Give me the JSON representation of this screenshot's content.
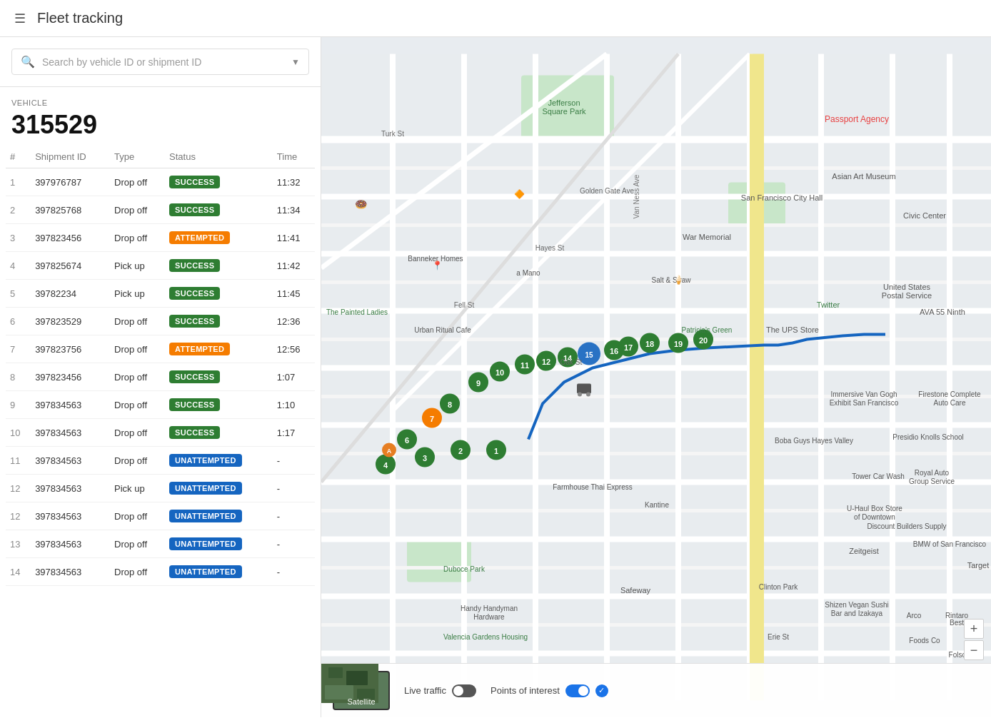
{
  "header": {
    "title": "Fleet tracking",
    "hamburger_label": "☰"
  },
  "sidebar": {
    "search": {
      "placeholder": "Search by vehicle ID or shipment ID"
    },
    "vehicle_label": "VEHICLE",
    "vehicle_id": "315529",
    "table": {
      "columns": [
        "#",
        "Shipment ID",
        "Type",
        "Status",
        "Time"
      ],
      "rows": [
        {
          "num": 1,
          "shipment_id": "397976787",
          "type": "Drop off",
          "status": "SUCCESS",
          "status_class": "success",
          "time": "11:32"
        },
        {
          "num": 2,
          "shipment_id": "397825768",
          "type": "Drop off",
          "status": "SUCCESS",
          "status_class": "success",
          "time": "11:34"
        },
        {
          "num": 3,
          "shipment_id": "397823456",
          "type": "Drop off",
          "status": "ATTEMPTED",
          "status_class": "attempted",
          "time": "11:41"
        },
        {
          "num": 4,
          "shipment_id": "397825674",
          "type": "Pick up",
          "status": "SUCCESS",
          "status_class": "success",
          "time": "11:42"
        },
        {
          "num": 5,
          "shipment_id": "39782234",
          "type": "Pick up",
          "status": "SUCCESS",
          "status_class": "success",
          "time": "11:45"
        },
        {
          "num": 6,
          "shipment_id": "397823529",
          "type": "Drop off",
          "status": "SUCCESS",
          "status_class": "success",
          "time": "12:36"
        },
        {
          "num": 7,
          "shipment_id": "397823756",
          "type": "Drop off",
          "status": "ATTEMPTED",
          "status_class": "attempted",
          "time": "12:56"
        },
        {
          "num": 8,
          "shipment_id": "397823456",
          "type": "Drop off",
          "status": "SUCCESS",
          "status_class": "success",
          "time": "1:07"
        },
        {
          "num": 9,
          "shipment_id": "397834563",
          "type": "Drop off",
          "status": "SUCCESS",
          "status_class": "success",
          "time": "1:10"
        },
        {
          "num": 10,
          "shipment_id": "397834563",
          "type": "Drop off",
          "status": "SUCCESS",
          "status_class": "success",
          "time": "1:17"
        },
        {
          "num": 11,
          "shipment_id": "397834563",
          "type": "Drop off",
          "status": "UNATTEMPTED",
          "status_class": "unattempted",
          "time": "-"
        },
        {
          "num": 12,
          "shipment_id": "397834563",
          "type": "Pick up",
          "status": "UNATTEMPTED",
          "status_class": "unattempted",
          "time": "-"
        },
        {
          "num": 12,
          "shipment_id": "397834563",
          "type": "Drop off",
          "status": "UNATTEMPTED",
          "status_class": "unattempted",
          "time": "-"
        },
        {
          "num": 13,
          "shipment_id": "397834563",
          "type": "Drop off",
          "status": "UNATTEMPTED",
          "status_class": "unattempted",
          "time": "-"
        },
        {
          "num": 14,
          "shipment_id": "397834563",
          "type": "Drop off",
          "status": "UNATTEMPTED",
          "status_class": "unattempted",
          "time": "-"
        }
      ]
    }
  },
  "map": {
    "satellite_label": "Satellite",
    "live_traffic_label": "Live traffic",
    "points_of_interest_label": "Points of interest",
    "zoom_in": "+",
    "zoom_out": "−"
  }
}
